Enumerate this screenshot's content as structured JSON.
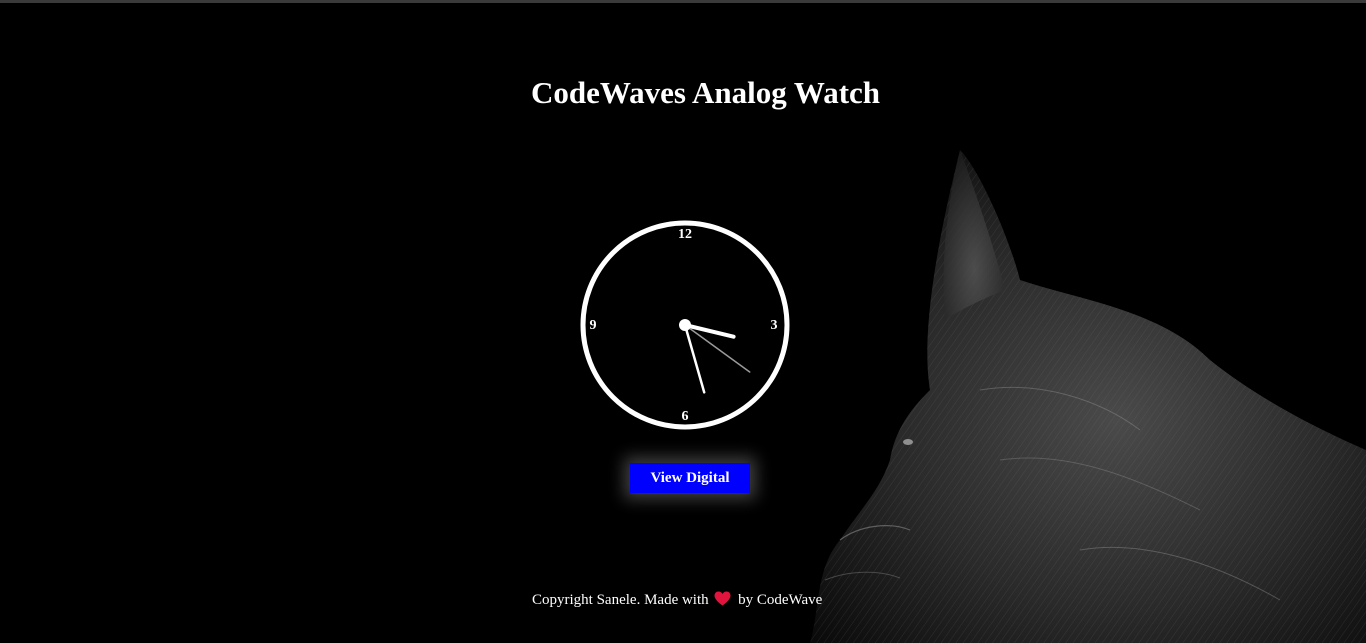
{
  "page": {
    "title": "CodeWaves Analog Watch"
  },
  "clock": {
    "numbers": [
      "12",
      "3",
      "6",
      "9"
    ],
    "time": {
      "hour": 3,
      "minute": 27,
      "second": 21
    }
  },
  "button": {
    "label": "View Digital"
  },
  "footer": {
    "before_heart": "Copyright Sanele. Made with",
    "after_heart": "by CodeWave",
    "heart_icon": "heart-icon",
    "heart_color": "#e0143c"
  },
  "colors": {
    "background": "#000000",
    "button": "#0000ff",
    "clock": "#ffffff"
  }
}
